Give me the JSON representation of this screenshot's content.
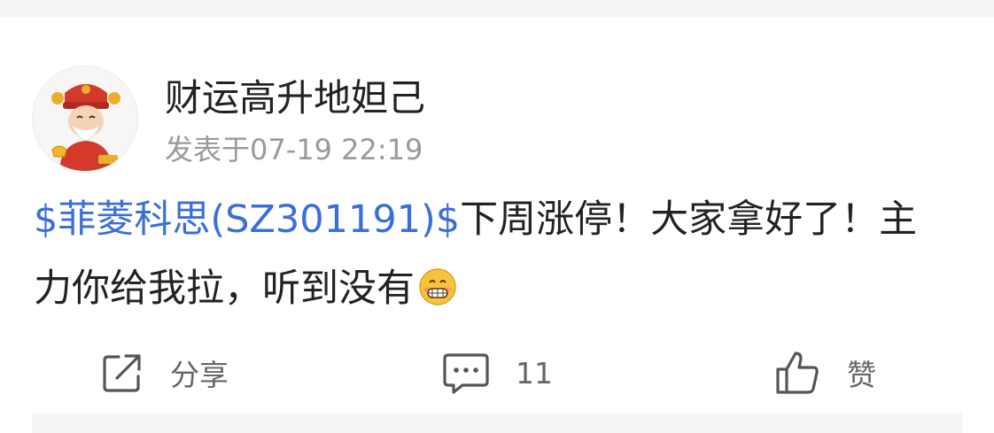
{
  "post": {
    "username": "财运高升地妲己",
    "timestamp": "发表于07-19 22:19",
    "stock_tag": "$菲菱科思(SZ301191)$",
    "content": "下周涨停！大家拿好了！主力你给我拉，听到没有"
  },
  "actions": {
    "share_label": "分享",
    "comment_count": "11",
    "like_label": "赞"
  },
  "icons": {
    "avatar": "god-of-wealth-avatar",
    "emoji": "grinning-face-emoji",
    "share": "share-icon",
    "comment": "comment-icon",
    "like": "thumbs-up-icon"
  },
  "colors": {
    "link": "#3a6fd8",
    "text": "#222222",
    "secondary": "#9a9a9a",
    "icon": "#555555"
  }
}
